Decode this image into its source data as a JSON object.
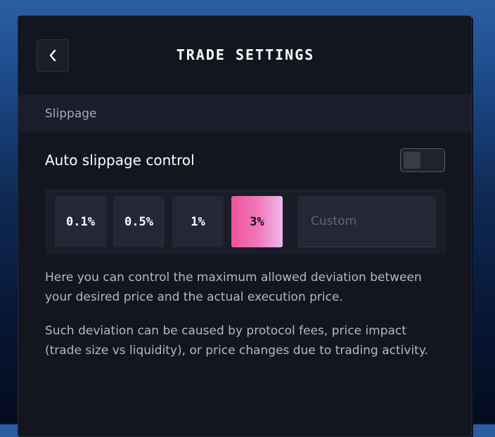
{
  "header": {
    "title": "TRADE SETTINGS",
    "back_icon": "chevron-left-icon"
  },
  "section": {
    "label": "Slippage"
  },
  "auto_slippage": {
    "label": "Auto slippage control",
    "enabled": false
  },
  "slippage_options": [
    {
      "label": "0.1%",
      "selected": false
    },
    {
      "label": "0.5%",
      "selected": false
    },
    {
      "label": "1%",
      "selected": false
    },
    {
      "label": "3%",
      "selected": true
    }
  ],
  "custom": {
    "placeholder": "Custom",
    "value": ""
  },
  "description": [
    "Here you can control the maximum allowed deviation between your desired price and the actual execution price.",
    "Such deviation can be caused by protocol fees, price impact (trade size vs liquidity), or price changes due to trading activity."
  ],
  "colors": {
    "panel_background": "#13151f",
    "accent_gradient_start": "#f0539b",
    "accent_gradient_end": "#ecb8ee",
    "text_primary": "#ffffff",
    "text_secondary": "#b4b8c6"
  }
}
